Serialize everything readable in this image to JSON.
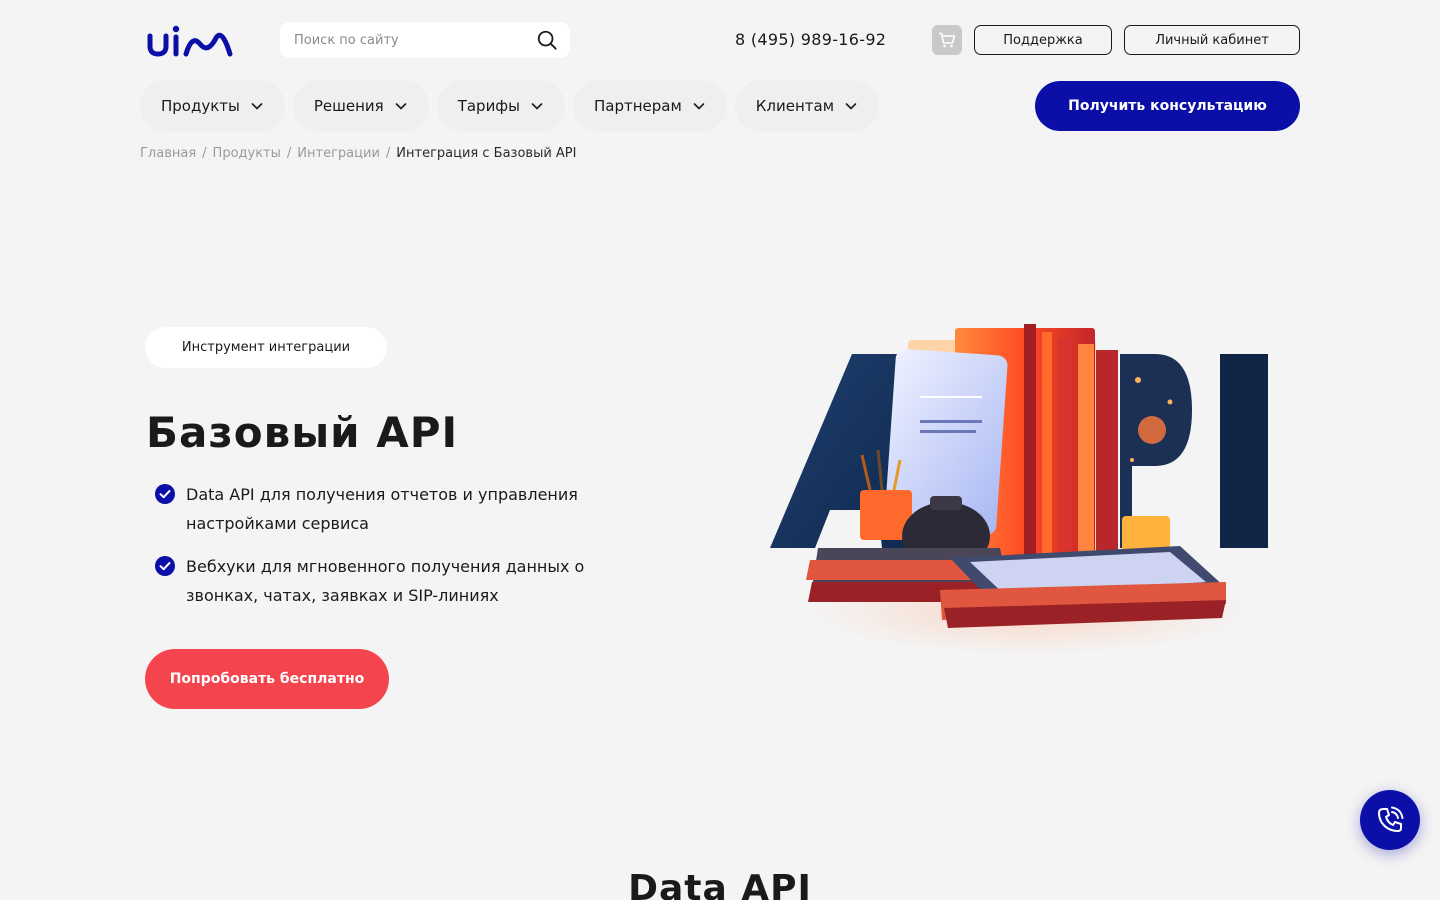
{
  "header": {
    "search_placeholder": "Поиск по сайту",
    "phone": "8 (495) 989-16-92",
    "support_label": "Поддержка",
    "account_label": "Личный кабинет"
  },
  "nav": {
    "items": [
      {
        "label": "Продукты"
      },
      {
        "label": "Решения"
      },
      {
        "label": "Тарифы"
      },
      {
        "label": "Партнерам"
      },
      {
        "label": "Клиентам"
      }
    ],
    "consult_label": "Получить консультацию"
  },
  "breadcrumb": {
    "items": [
      "Главная",
      "Продукты",
      "Интеграции"
    ],
    "separator": "/",
    "current": "Интеграция с Базовый API"
  },
  "hero": {
    "tag": "Инструмент интеграции",
    "title": "Базовый API",
    "features": [
      "Data API для получения отчетов и управления настройками сервиса",
      "Вебхуки для мгновенного получения данных о звонках, чатах, заявках и SIP-линиях"
    ],
    "cta_label": "Попробовать бесплатно"
  },
  "section": {
    "title": "Data API"
  },
  "colors": {
    "brand": "#0b0fa8",
    "accent": "#f4454f",
    "background": "#f4f4f4"
  },
  "icons": {
    "logo": "uis-logo",
    "search": "search-icon",
    "cart": "cart-icon",
    "chevron": "chevron-down-icon",
    "check": "check-circle-icon",
    "call": "phone-call-icon"
  }
}
